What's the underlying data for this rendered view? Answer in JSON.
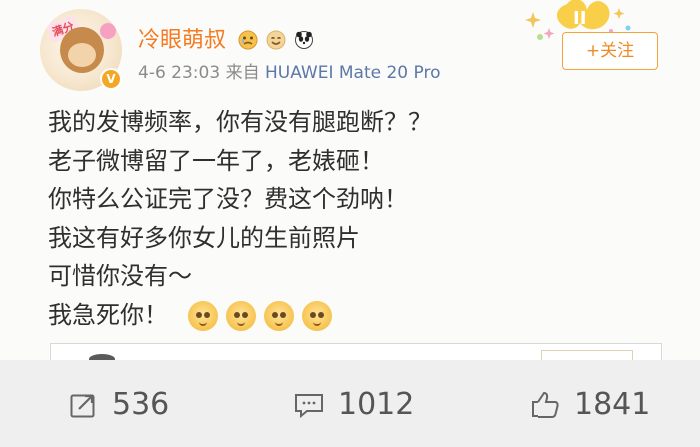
{
  "post": {
    "username": "冷眼萌叔",
    "meta_time": "4-6 23:03",
    "meta_source_prefix": "来自",
    "meta_source_name": "HUAWEI Mate 20 Pro",
    "follow_label": "+关注",
    "avatar_tag": "满分",
    "lines": [
      "我的发博频率，你有没有腿跑断？？",
      "老子微博留了一年了，老婊砸！",
      "你特么公证完了没？费这个劲呐！",
      "我这有好多你女儿的生前照片",
      "可惜你没有～",
      "我急死你！"
    ],
    "name_icon_names": [
      "crying-face-icon",
      "smiling-face-icon",
      "panda-icon"
    ],
    "line_emoji_names": [
      "sweat-face-icon",
      "sweat-face-icon",
      "sweat-face-icon",
      "sweat-face-icon"
    ],
    "colors": {
      "username": "#f47b20",
      "follow": "#f08b24",
      "follow_border": "#f4a33b",
      "meta_source": "#5c78a8",
      "text": "#2f2f2f",
      "card_bg": "#fbfbfa",
      "bottom_bg": "#efefef"
    }
  },
  "actions": {
    "repost_count": "536",
    "comment_count": "1012",
    "like_count": "1841",
    "repost_icon": "repost-icon",
    "comment_icon": "comment-icon",
    "like_icon": "thumbs-up-icon"
  }
}
